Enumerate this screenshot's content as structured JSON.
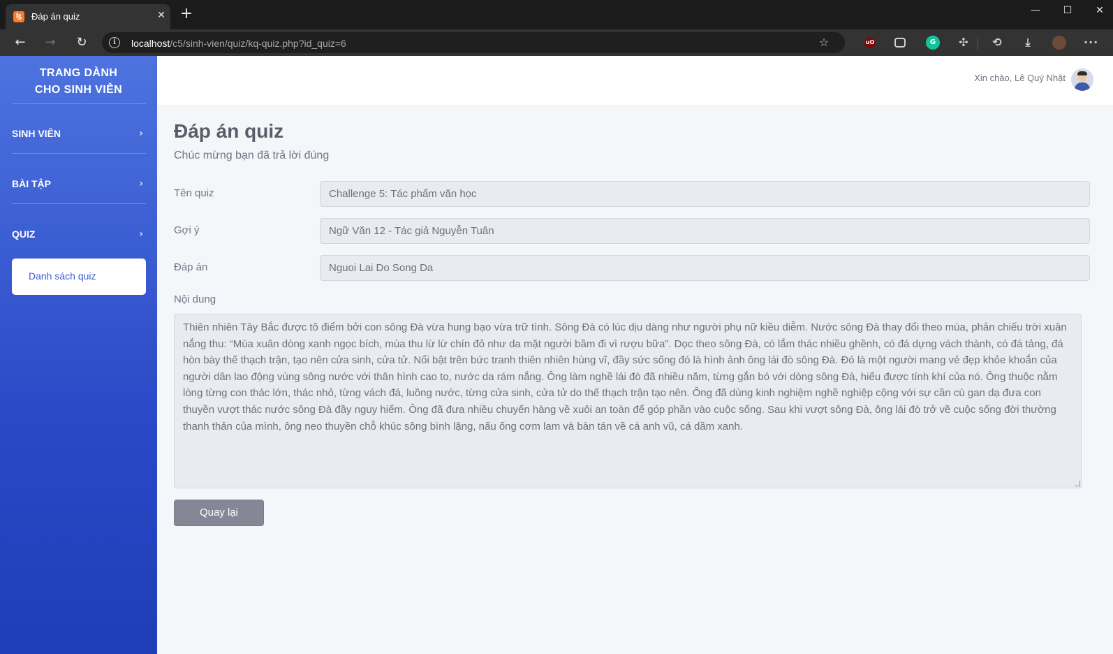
{
  "browser": {
    "tab_title": "Đáp án quiz",
    "url_host": "localhost",
    "url_path": "/c5/sinh-vien/quiz/kq-quiz.php?id_quiz=6"
  },
  "sidebar": {
    "brand_line1": "TRANG DÀNH",
    "brand_line2": "CHO SINH VIÊN",
    "items": [
      {
        "label": "SINH VIÊN"
      },
      {
        "label": "BÀI TẬP"
      },
      {
        "label": "QUIZ"
      }
    ],
    "active_subitem": "Danh sách quiz"
  },
  "topbar": {
    "greeting": "Xin chào, Lê Quý Nhật"
  },
  "main": {
    "title": "Đáp án quiz",
    "subtitle": "Chúc mừng bạn đã trả lời đúng",
    "fields": [
      {
        "label": "Tên quiz",
        "value": "Challenge 5: Tác phẩm văn học"
      },
      {
        "label": "Gợi ý",
        "value": "Ngữ Văn 12 - Tác giả Nguyễn Tuân"
      },
      {
        "label": "Đáp án",
        "value": "Nguoi Lai Do Song Da"
      }
    ],
    "content_label": "Nội dung",
    "content": "Thiên nhiên Tây Bắc được tô điểm bởi con sông Đà vừa hung bạo vừa trữ tình. Sông Đà có lúc dịu dàng như người phụ nữ kiều diễm. Nước sông Đà thay đổi theo mùa, phản chiếu trời xuân nắng thu: “Mùa xuân dòng xanh ngọc bích, mùa thu lừ lừ chín đỏ như da mặt người bầm đi vì rượu bữa”. Dọc theo sông Đà, có lắm thác nhiều ghềnh, có đá dựng vách thành, có đá tảng, đá hòn bày thế thạch trận, tạo nên cửa sinh, cửa tử. Nổi bật trên bức tranh thiên nhiên hùng vĩ, đầy sức sống đó là hình ảnh ông lái đò sông Đà. Đó là một người mang vẻ đẹp khỏe khoắn của người dân lao động vùng sông nước với thân hình cao to, nước da rám nắng. Ông làm nghề lái đò đã nhiều năm, từng gắn bó với dòng sông Đà, hiểu được tính khí của nó. Ông thuộc nằm lòng từng con thác lớn, thác nhỏ, từng vách đá, luồng nước, từng cửa sinh, cửa tử do thế thạch trận tạo nên. Ông đã dùng kinh nghiệm nghề nghiệp cộng với sự cần cù gan dạ đưa con thuyền vượt thác nước sông Đà đầy nguy hiểm. Ông đã đưa nhiều chuyến hàng về xuôi an toàn để góp phần vào cuộc sống. Sau khi vượt sông Đà, ông lái đò trở về cuộc sống đời thường thanh thản của mình, ông neo thuyền chỗ khúc sông bình lặng, nấu ống cơm lam và bàn tán về cá anh vũ, cá dầm xanh.",
    "back_button": "Quay lại"
  },
  "colors": {
    "sidebar_top": "#4e73df",
    "sidebar_bottom": "#1e3db8",
    "page_bg": "#f5f6fa",
    "button_gray": "#858796"
  }
}
